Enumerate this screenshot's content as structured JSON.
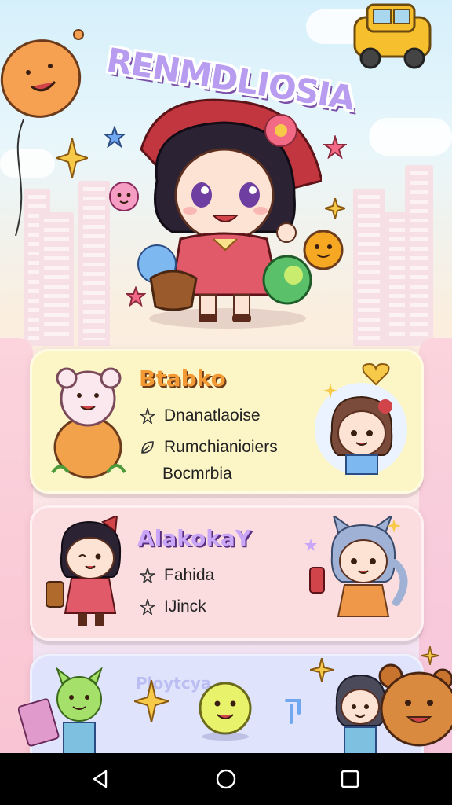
{
  "app": {
    "title": "RENMDLIOSIA"
  },
  "cards": [
    {
      "id": "card1",
      "title": "Btabko",
      "rows": [
        {
          "icon": "star-icon",
          "text": "Dnanatlaoise"
        },
        {
          "icon": "leaf-icon",
          "text": "Rumchianioiers"
        },
        {
          "icon": "",
          "text": "Bocmrbia"
        }
      ]
    },
    {
      "id": "card2",
      "title": "AlakokaY",
      "rows": [
        {
          "icon": "star-icon",
          "text": "Fahida"
        },
        {
          "icon": "star-icon",
          "text": "IJinck"
        }
      ]
    },
    {
      "id": "card3",
      "title": "Ploytcya"
    }
  ],
  "colors": {
    "card1_bg": "#fcf6c7",
    "card2_bg": "#fbdde0",
    "card3_bg": "#dfe3fb",
    "title_accent": "#f39a34"
  },
  "navbar": {
    "back": "back-triangle-icon",
    "home": "home-circle-icon",
    "recents": "recents-square-icon"
  }
}
